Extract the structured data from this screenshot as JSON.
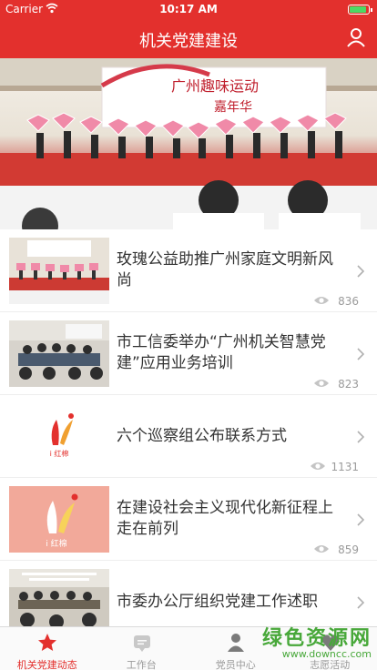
{
  "status_bar": {
    "carrier": "Carrier",
    "time": "10:17 AM"
  },
  "header": {
    "title": "机关党建建设"
  },
  "banner": {
    "sign_text": "广州趣味运动",
    "sign_sub": "嘉年华"
  },
  "articles": [
    {
      "title": "玫瑰公益助推广州家庭文明新风尚",
      "views": "836"
    },
    {
      "title": "市工信委举办“广州机关智慧党建”应用业务培训",
      "views": "823"
    },
    {
      "title": "六个巡察组公布联系方式",
      "views": "1131",
      "logo_text": "i 红棉"
    },
    {
      "title": "在建设社会主义现代化新征程上走在前列",
      "views": "859",
      "logo_text": "i 红棉"
    },
    {
      "title": "市委办公厅组织党建工作述职",
      "views": ""
    }
  ],
  "tabs": [
    {
      "label": "机关党建动态",
      "icon": "star-icon",
      "active": true
    },
    {
      "label": "工作台",
      "icon": "workbench-icon",
      "active": false
    },
    {
      "label": "党员中心",
      "icon": "member-icon",
      "active": false
    },
    {
      "label": "志愿活动",
      "icon": "volunteer-icon",
      "active": false
    }
  ],
  "watermark": {
    "text": "绿色资源网",
    "url": "www.downcc.com"
  },
  "colors": {
    "brand": "#e3302d",
    "text": "#333333",
    "muted": "#9b9b9b"
  }
}
